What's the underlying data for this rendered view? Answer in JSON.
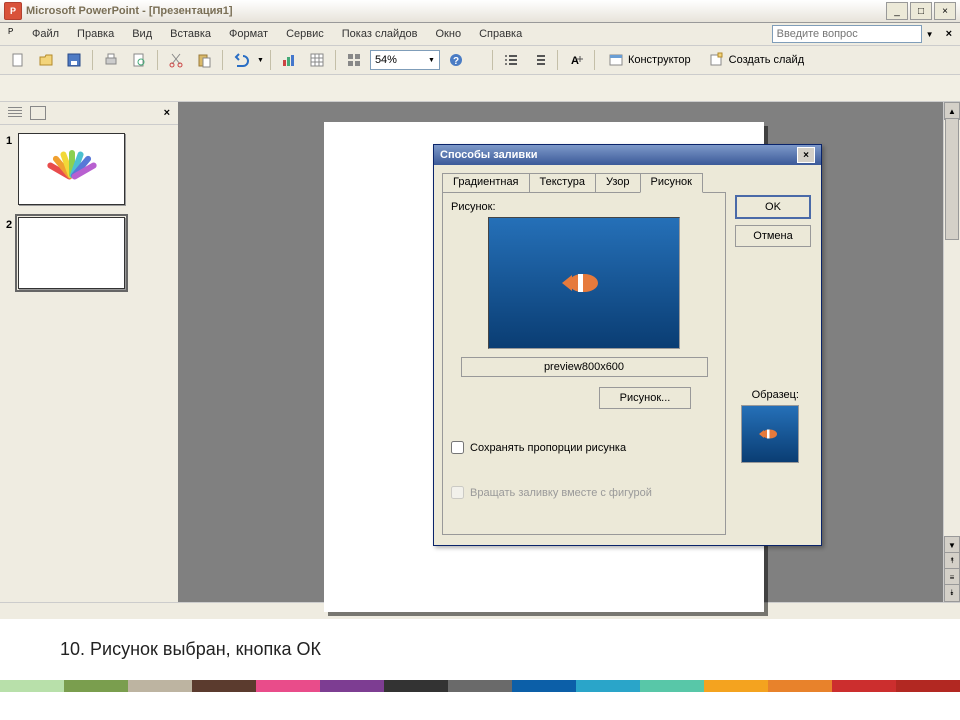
{
  "title": "Microsoft PowerPoint - [Презентация1]",
  "menu": [
    "Файл",
    "Правка",
    "Вид",
    "Вставка",
    "Формат",
    "Сервис",
    "Показ слайдов",
    "Окно",
    "Справка"
  ],
  "help_placeholder": "Введите вопрос",
  "zoom": "54%",
  "toolbar_designer": "Конструктор",
  "toolbar_newslide": "Создать слайд",
  "thumbs": [
    {
      "num": "1",
      "sel": false
    },
    {
      "num": "2",
      "sel": true
    }
  ],
  "dialog": {
    "title": "Способы заливки",
    "tabs": [
      "Градиентная",
      "Текстура",
      "Узор",
      "Рисунок"
    ],
    "active": 3,
    "picture_label": "Рисунок:",
    "filename": "preview800x600",
    "browse": "Рисунок...",
    "ok": "OK",
    "cancel": "Отмена",
    "sample": "Образец:",
    "lock": "Сохранять пропорции рисунка",
    "rotate": "Вращать заливку вместе с фигурой"
  },
  "caption": "10.   Рисунок выбран, кнопка ОК",
  "footer_colors": [
    "#b8e0aa",
    "#7a9e4e",
    "#bdb4a1",
    "#5b3b2e",
    "#e94c8a",
    "#7d3d92",
    "#333",
    "#6a6a6a",
    "#0c5fa8",
    "#2aa5c9",
    "#58c7a8",
    "#f4a31f",
    "#e8822b",
    "#cc2e2e",
    "#b22822"
  ]
}
